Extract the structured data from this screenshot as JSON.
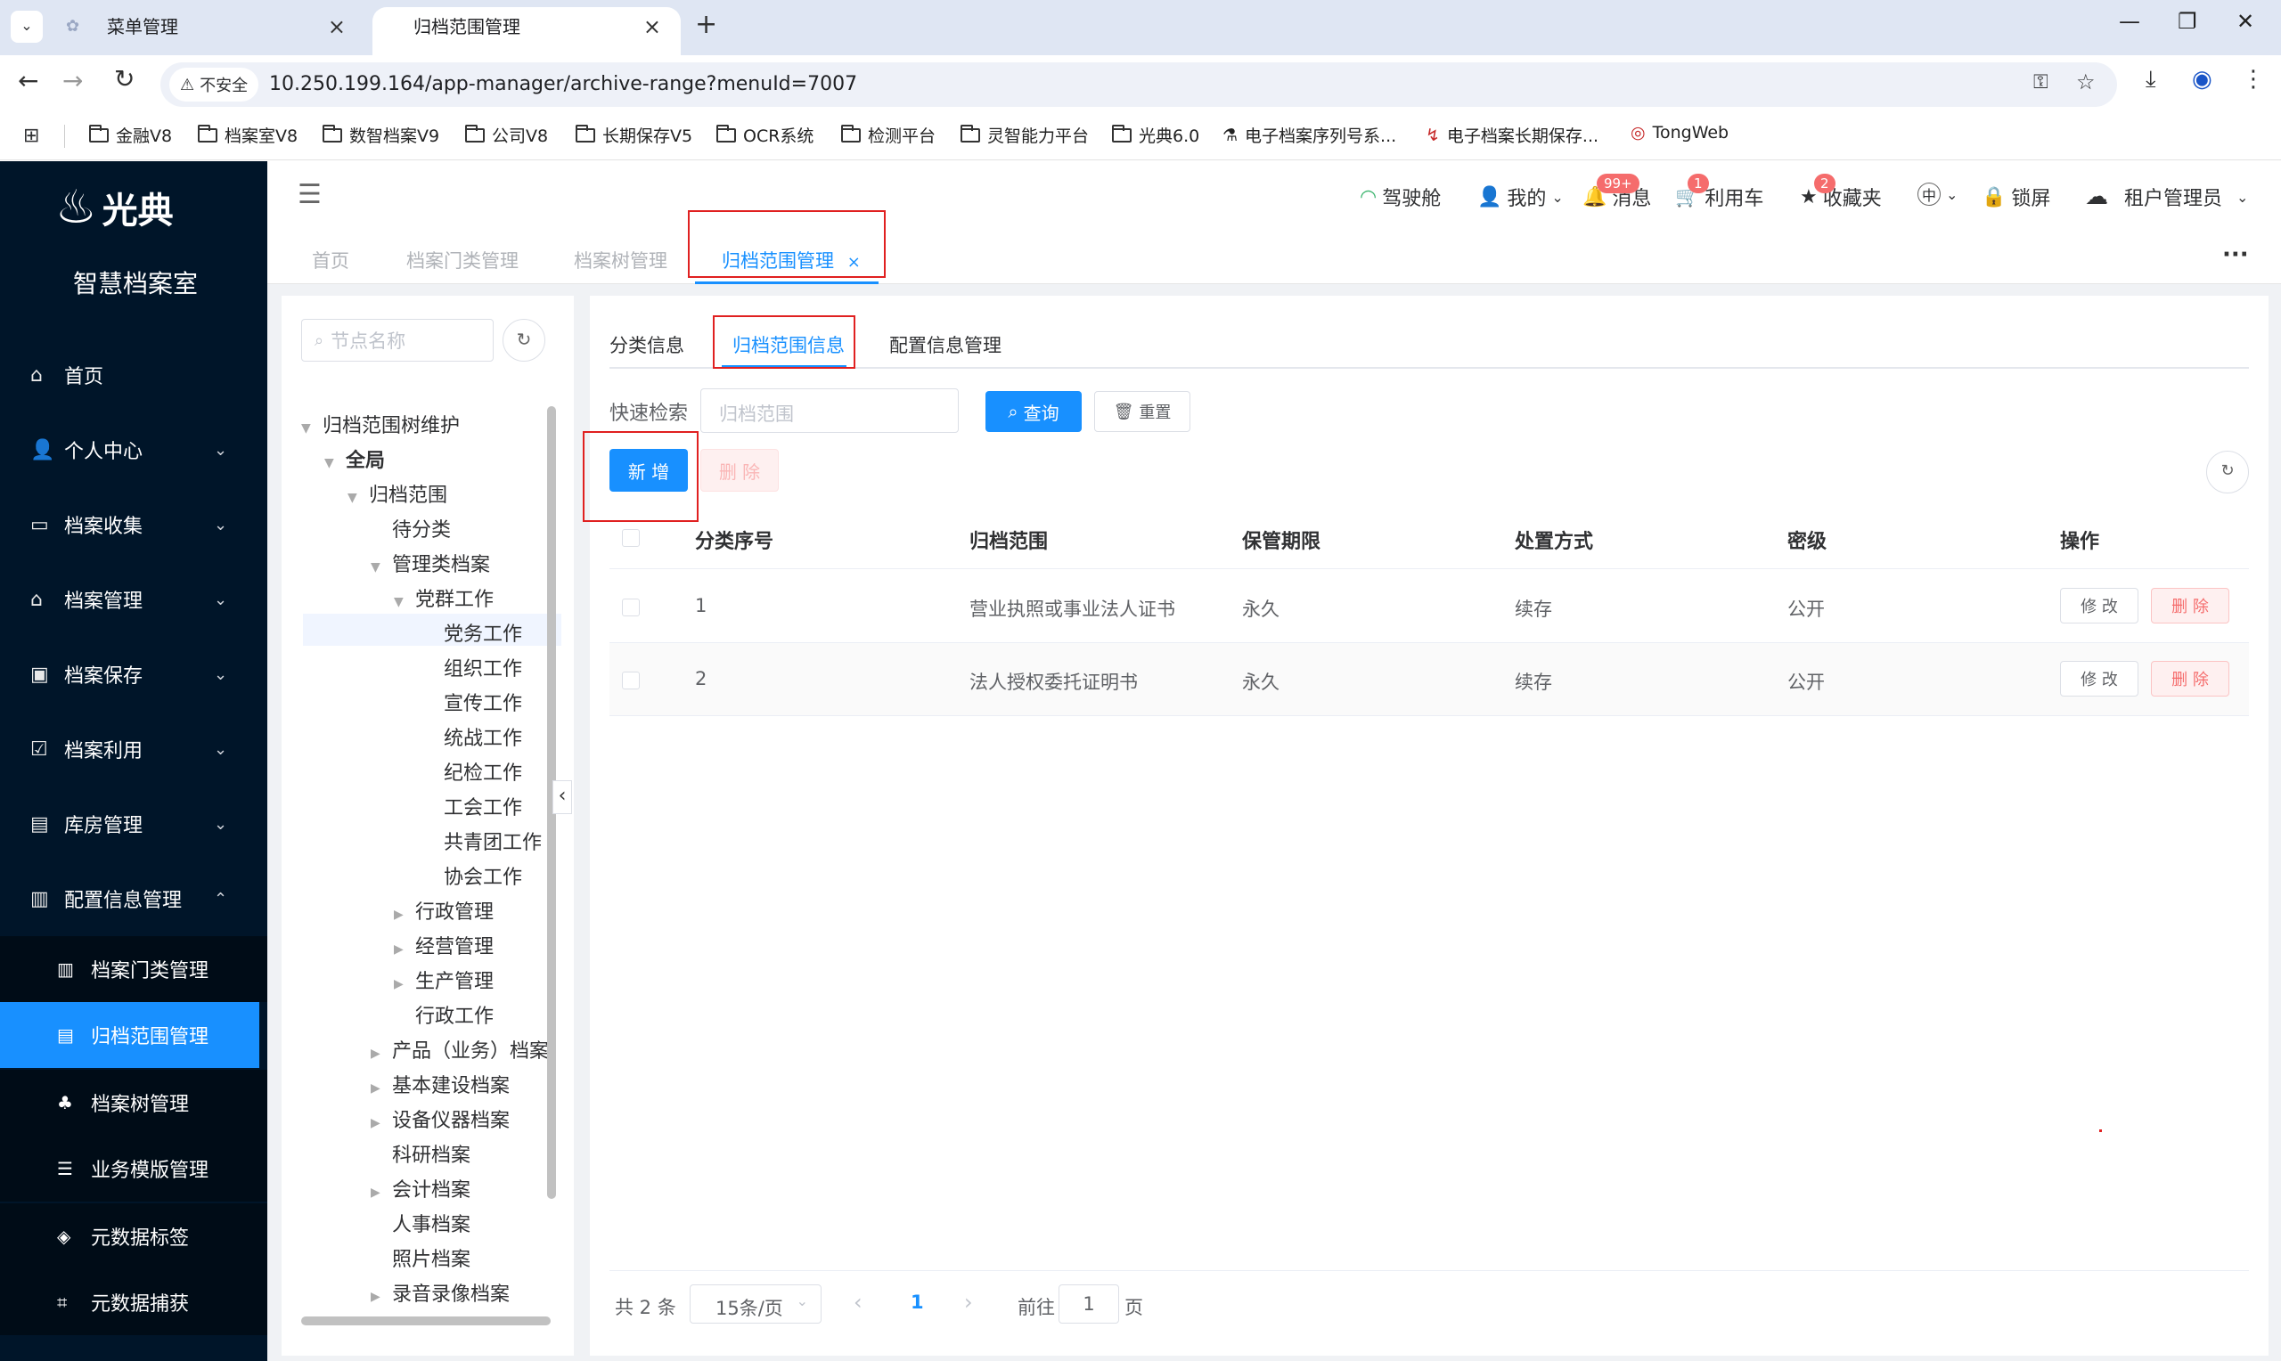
{
  "browser": {
    "tabs": [
      {
        "label": "菜单管理",
        "active": false
      },
      {
        "label": "归档范围管理",
        "active": true
      }
    ],
    "security_label": "不安全",
    "url": "10.250.199.164/app-manager/archive-range?menuId=7007",
    "bookmarks": [
      "金融V8",
      "档案室V8",
      "数智档案V9",
      "公司V8",
      "长期保存V5",
      "OCR系统",
      "检测平台",
      "灵智能力平台",
      "光典6.0",
      "电子档案序列号系...",
      "电子档案长期保存...",
      "TongWeb"
    ]
  },
  "brand": {
    "logo_text": "光典",
    "subtitle": "智慧档案室"
  },
  "sidebar": {
    "items": [
      {
        "label": "首页",
        "icon": "home-icon"
      },
      {
        "label": "个人中心",
        "icon": "user-icon"
      },
      {
        "label": "档案收集",
        "icon": "inbox-icon"
      },
      {
        "label": "档案管理",
        "icon": "bank-icon"
      },
      {
        "label": "档案保存",
        "icon": "save-icon"
      },
      {
        "label": "档案利用",
        "icon": "clipboard-icon"
      },
      {
        "label": "库房管理",
        "icon": "building-icon"
      },
      {
        "label": "配置信息管理",
        "icon": "config-icon"
      }
    ],
    "subitems": [
      {
        "label": "档案门类管理",
        "icon": "books-icon"
      },
      {
        "label": "归档范围管理",
        "icon": "document-icon",
        "active": true
      },
      {
        "label": "档案树管理",
        "icon": "tree-icon"
      },
      {
        "label": "业务模版管理",
        "icon": "template-icon"
      },
      {
        "label": "元数据标签",
        "icon": "tag-icon"
      },
      {
        "label": "元数据捕获",
        "icon": "crop-icon"
      }
    ]
  },
  "header": {
    "cockpit": "驾驶舱",
    "mine": "我的",
    "messages": "消息",
    "messages_badge": "99+",
    "cart": "利用车",
    "cart_badge": "1",
    "favorites": "收藏夹",
    "favorites_badge": "2",
    "lang": "中",
    "lock": "锁屏",
    "user": "租户管理员"
  },
  "tags": [
    "首页",
    "档案门类管理",
    "档案树管理",
    "归档范围管理"
  ],
  "tree": {
    "search_placeholder": "节点名称",
    "nodes": [
      {
        "label": "归档范围树维护",
        "level": 0,
        "arrow": "open"
      },
      {
        "label": "全局",
        "level": 1,
        "arrow": "open",
        "bold": true
      },
      {
        "label": "归档范围",
        "level": 2,
        "arrow": "open"
      },
      {
        "label": "待分类",
        "level": 3,
        "arrow": "none"
      },
      {
        "label": "管理类档案",
        "level": 3,
        "arrow": "open"
      },
      {
        "label": "党群工作",
        "level": 4,
        "arrow": "open"
      },
      {
        "label": "党务工作",
        "level": 5,
        "arrow": "none",
        "selected": true
      },
      {
        "label": "组织工作",
        "level": 5,
        "arrow": "none"
      },
      {
        "label": "宣传工作",
        "level": 5,
        "arrow": "none"
      },
      {
        "label": "统战工作",
        "level": 5,
        "arrow": "none"
      },
      {
        "label": "纪检工作",
        "level": 5,
        "arrow": "none"
      },
      {
        "label": "工会工作",
        "level": 5,
        "arrow": "none"
      },
      {
        "label": "共青团工作",
        "level": 5,
        "arrow": "none"
      },
      {
        "label": "协会工作",
        "level": 5,
        "arrow": "none"
      },
      {
        "label": "行政管理",
        "level": 4,
        "arrow": "closed"
      },
      {
        "label": "经营管理",
        "level": 4,
        "arrow": "closed"
      },
      {
        "label": "生产管理",
        "level": 4,
        "arrow": "closed"
      },
      {
        "label": "行政工作",
        "level": 4,
        "arrow": "none"
      },
      {
        "label": "产品（业务）档案",
        "level": 3,
        "arrow": "closed"
      },
      {
        "label": "基本建设档案",
        "level": 3,
        "arrow": "closed"
      },
      {
        "label": "设备仪器档案",
        "level": 3,
        "arrow": "closed"
      },
      {
        "label": "科研档案",
        "level": 3,
        "arrow": "none"
      },
      {
        "label": "会计档案",
        "level": 3,
        "arrow": "closed"
      },
      {
        "label": "人事档案",
        "level": 3,
        "arrow": "none"
      },
      {
        "label": "照片档案",
        "level": 3,
        "arrow": "none"
      },
      {
        "label": "录音录像档案",
        "level": 3,
        "arrow": "closed"
      }
    ]
  },
  "main": {
    "tabs": [
      "分类信息",
      "归档范围信息",
      "配置信息管理"
    ],
    "active_tab": 1,
    "search_label": "快速检索",
    "search_placeholder": "归档范围",
    "query_label": "查询",
    "reset_label": "重置",
    "add_label": "新 增",
    "delete_label": "删 除",
    "columns": [
      "分类序号",
      "归档范围",
      "保管期限",
      "处置方式",
      "密级",
      "操作"
    ],
    "rows": [
      {
        "seq": "1",
        "range": "营业执照或事业法人证书",
        "period": "永久",
        "method": "续存",
        "level": "公开"
      },
      {
        "seq": "2",
        "range": "法人授权委托证明书",
        "period": "永久",
        "method": "续存",
        "level": "公开"
      }
    ],
    "edit_label": "修 改",
    "row_delete_label": "删 除",
    "pagination": {
      "total": "共 2 条",
      "page_size": "15条/页",
      "current": "1",
      "goto_label": "前往",
      "goto_value": "1",
      "page_unit": "页"
    }
  },
  "colors": {
    "sidebar_bg": "#001529",
    "primary": "#1890ff",
    "danger": "#f56c6c",
    "annotation": "#e02020"
  }
}
